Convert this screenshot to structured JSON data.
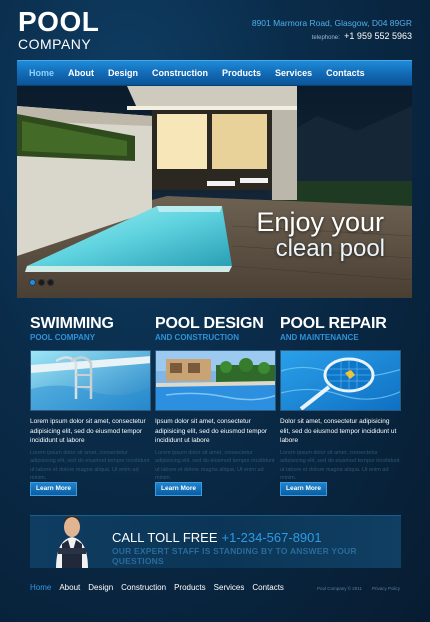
{
  "header": {
    "logo_top": "POOL",
    "logo_bottom": "COMPANY",
    "address": "8901 Marmora Road, Glasgow, D04 89GR",
    "phone_label": "telephone:",
    "phone": "+1 959 552 5963"
  },
  "nav_top": [
    "Home",
    "About",
    "Design",
    "Construction",
    "Products",
    "Services",
    "Contacts"
  ],
  "nav_top_active": 0,
  "hero": {
    "headline": "Enjoy your",
    "subline": "clean pool",
    "slides": 3,
    "active_slide": 0
  },
  "columns": [
    {
      "title": "SWIMMING",
      "subtitle": "POOL COMPANY",
      "text": "Lorem ipsum dolor sit amet, consectetur adipisicing elit, sed do eiusmod tempor incididunt ut labore",
      "small_text": "Lorem ipsum dolor sit amet, consectetur adipisicing elit, sed do eiusmod tempor incididunt ut labore et dolore magna aliqua. Ut enim ad minim.",
      "button": "Learn More"
    },
    {
      "title": "POOL DESIGN",
      "subtitle": "AND CONSTRUCTION",
      "text": "Ipsum dolor sit amet, consectetur adipisicing elit, sed do eiusmod tempor incididunt ut labore",
      "small_text": "Lorem ipsum dolor sit amet, consectetur adipisicing elit, sed do eiusmod tempor incididunt ut labore et dolore magna aliqua. Ut enim ad minim.",
      "button": "Learn More"
    },
    {
      "title": "POOL REPAIR",
      "subtitle": "AND MAINTENANCE",
      "text": "Dolor sit amet, consectetur adipisicing elit, sed do eiusmod tempor incididunt ut labore",
      "small_text": "Lorem ipsum dolor sit amet, consectetur adipisicing elit, sed do eiusmod tempor incididunt ut labore et dolore magna aliqua. Ut enim ad minim.",
      "button": "Learn More"
    }
  ],
  "banner": {
    "call_label": "CALL TOLL FREE",
    "phone": "+1-234-567-8901",
    "tagline": "OUR EXPERT STAFF IS STANDING BY TO ANSWER YOUR QUESTIONS"
  },
  "nav_bottom": [
    "Home",
    "About",
    "Design",
    "Construction",
    "Products",
    "Services",
    "Contacts"
  ],
  "nav_bottom_active": 0,
  "footer": {
    "copyright": "Pool Company © 2011",
    "privacy": "Privacy Policy"
  },
  "colors": {
    "accent": "#1f8ad8",
    "background": "#0a2c4a",
    "subtitle": "#2d92d8"
  }
}
